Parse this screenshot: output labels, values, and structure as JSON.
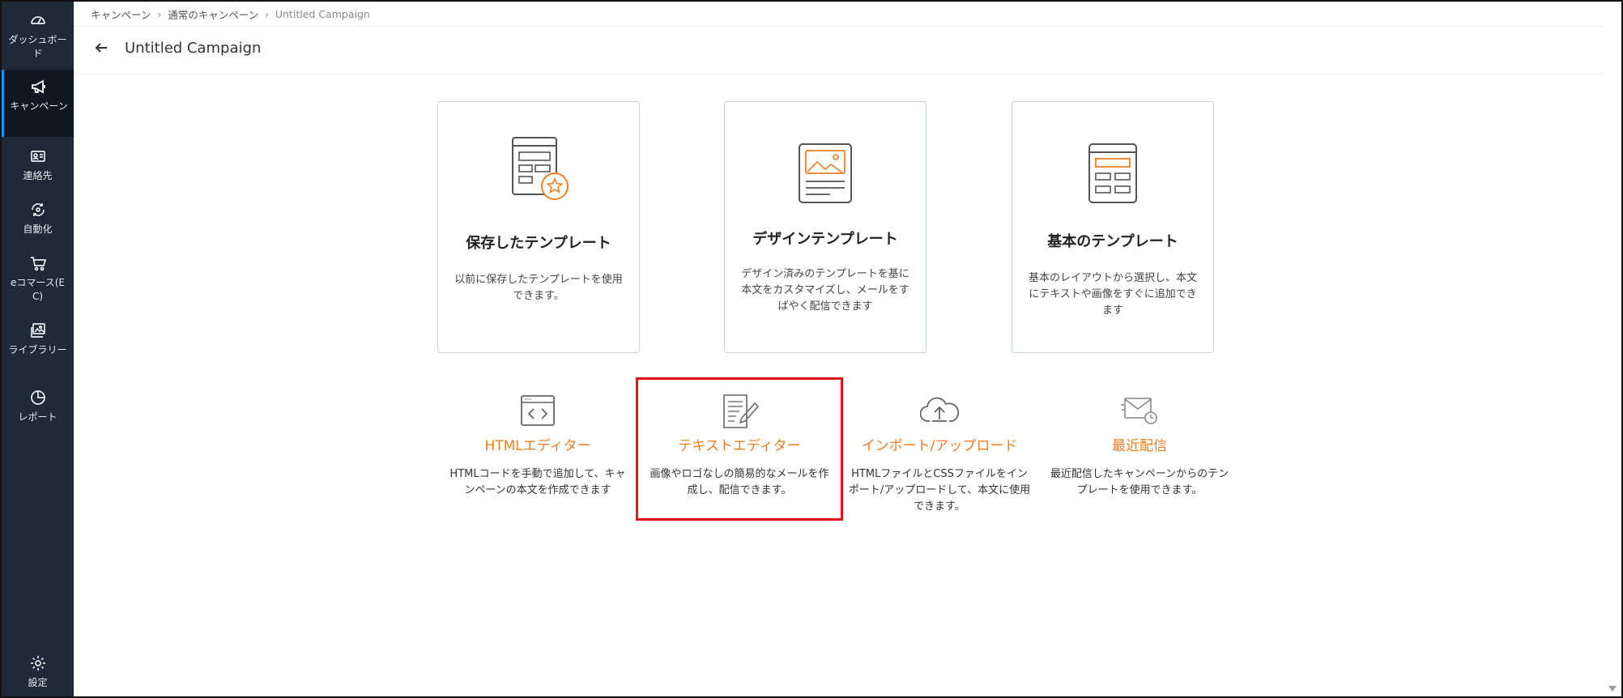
{
  "sidebar": {
    "items": [
      {
        "label": "ダッシュボード",
        "icon": "gauge-icon"
      },
      {
        "label": "キャンペーン",
        "icon": "megaphone-icon",
        "active": true
      },
      {
        "label": "連絡先",
        "icon": "contact-card-icon"
      },
      {
        "label": "自動化",
        "icon": "automation-icon"
      },
      {
        "label": "eコマース(EC)",
        "icon": "cart-icon"
      },
      {
        "label": "ライブラリー",
        "icon": "images-icon"
      },
      {
        "label": "レポート",
        "icon": "pie-chart-icon"
      }
    ],
    "settings": {
      "label": "設定",
      "icon": "gear-icon"
    }
  },
  "header": {
    "breadcrumb": [
      "キャンペーン",
      "通常のキャンペーン",
      "Untitled Campaign"
    ],
    "title": "Untitled Campaign"
  },
  "cards": [
    {
      "title": "保存したテンプレート",
      "desc": "以前に保存したテンプレートを使用できます。",
      "icon": "saved-template-icon"
    },
    {
      "title": "デザインテンプレート",
      "desc": "デザイン済みのテンプレートを基に本文をカスタマイズし、メールをすばやく配信できます",
      "icon": "design-template-icon"
    },
    {
      "title": "基本のテンプレート",
      "desc": "基本のレイアウトから選択し、本文にテキストや画像をすぐに追加できます",
      "icon": "basic-template-icon"
    }
  ],
  "options": [
    {
      "title": "HTMLエディター",
      "desc": "HTMLコードを手動で追加して、キャンペーンの本文を作成できます",
      "icon": "code-window-icon"
    },
    {
      "title": "テキストエディター",
      "desc": "画像やロゴなしの簡易的なメールを作成し、配信できます。",
      "icon": "text-edit-icon",
      "selected": true
    },
    {
      "title": "インポート/アップロード",
      "desc": "HTMLファイルとCSSファイルをインポート/アップロードして、本文に使用できます。",
      "icon": "cloud-upload-icon"
    },
    {
      "title": "最近配信",
      "desc": "最近配信したキャンペーンからのテンプレートを使用できます。",
      "icon": "recent-mail-icon"
    }
  ],
  "colors": {
    "sidebar": "#1f2a38",
    "accent": "#f07f23",
    "selected_border": "#e01414",
    "active_indicator": "#1e90ff"
  }
}
